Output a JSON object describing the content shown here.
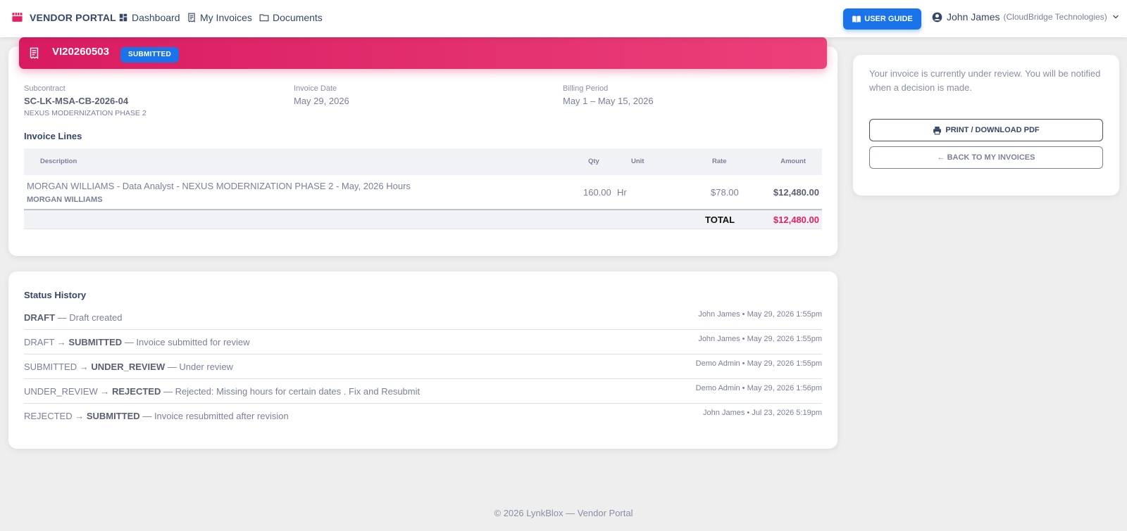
{
  "nav": {
    "brand": "VENDOR PORTAL",
    "links": [
      {
        "label": "Dashboard",
        "icon": "dashboard-icon"
      },
      {
        "label": "My Invoices",
        "icon": "receipt-icon"
      },
      {
        "label": "Documents",
        "icon": "folder-icon"
      }
    ],
    "user_guide": "USER GUIDE",
    "user_name": "John James",
    "user_company": "(CloudBridge Technologies)"
  },
  "invoice": {
    "id": "VI20260503",
    "status": "SUBMITTED",
    "subcontract_label": "Subcontract",
    "subcontract_value": "SC-LK-MSA-CB-2026-04",
    "subcontract_project": "NEXUS MODERNIZATION PHASE 2",
    "date_label": "Invoice Date",
    "date_value": "May 29, 2026",
    "period_label": "Billing Period",
    "period_value": "May 1 – May 15, 2026"
  },
  "lines": {
    "title": "Invoice Lines",
    "headers": {
      "description": "Description",
      "qty": "Qty",
      "unit": "Unit",
      "rate": "Rate",
      "amount": "Amount"
    },
    "rows": [
      {
        "description": "MORGAN WILLIAMS - Data Analyst - NEXUS MODERNIZATION PHASE 2 - May, 2026 Hours",
        "worker": "MORGAN WILLIAMS",
        "qty": "160.00",
        "unit": "Hr",
        "rate": "$78.00",
        "amount": "$12,480.00"
      }
    ],
    "total_label": "TOTAL",
    "total_amount": "$12,480.00"
  },
  "history": {
    "title": "Status History",
    "entries": [
      {
        "from": "",
        "to": "DRAFT",
        "note": "— Draft created",
        "meta": "John James • May 29, 2026 1:55pm"
      },
      {
        "from": "DRAFT →",
        "to": "SUBMITTED",
        "note": "— Invoice submitted for review",
        "meta": "John James • May 29, 2026 1:55pm"
      },
      {
        "from": "SUBMITTED →",
        "to": "UNDER_REVIEW",
        "note": "— Under review",
        "meta": "Demo Admin • May 29, 2026 1:55pm"
      },
      {
        "from": "UNDER_REVIEW →",
        "to": "REJECTED",
        "note": "— Rejected: Missing hours for certain dates . Fix and Resubmit",
        "meta": "Demo Admin • May 29, 2026 1:56pm"
      },
      {
        "from": "REJECTED →",
        "to": "SUBMITTED",
        "note": "— Invoice resubmitted after revision",
        "meta": "John James • Jul 23, 2026 5:19pm"
      }
    ]
  },
  "side": {
    "message": "Your invoice is currently under review. You will be notified when a decision is made.",
    "print_label": "PRINT / DOWNLOAD PDF",
    "back_label": "← BACK TO MY INVOICES"
  },
  "footer": "© 2026 LynkBlox — Vendor Portal",
  "colors": {
    "accent": "#e91e63",
    "primary": "#1a73e8",
    "text": "#344767",
    "muted": "#7b809a"
  }
}
